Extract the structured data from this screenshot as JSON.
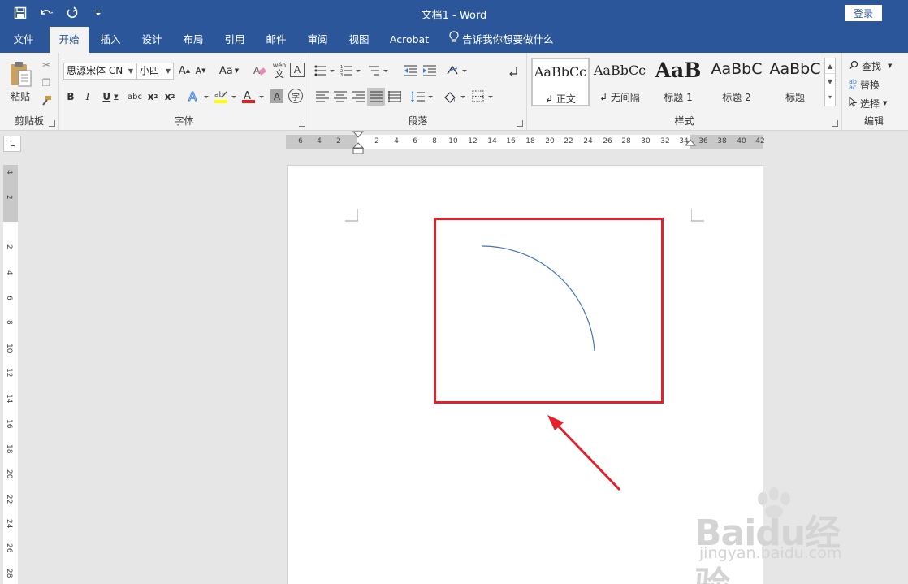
{
  "window": {
    "title": "文档1  -  Word",
    "login_label": "登录"
  },
  "qat": {
    "save_icon": "save-icon",
    "undo_icon": "undo-icon",
    "redo_icon": "redo-icon"
  },
  "tabs": [
    {
      "label": "文件"
    },
    {
      "label": "开始",
      "active": true
    },
    {
      "label": "插入"
    },
    {
      "label": "设计"
    },
    {
      "label": "布局"
    },
    {
      "label": "引用"
    },
    {
      "label": "邮件"
    },
    {
      "label": "审阅"
    },
    {
      "label": "视图"
    },
    {
      "label": "Acrobat"
    }
  ],
  "tellme": "告诉我你想要做什么",
  "ribbon": {
    "clipboard": {
      "label": "剪贴板",
      "paste_label": "粘贴"
    },
    "font": {
      "label": "字体",
      "font_name": "思源宋体 CN",
      "font_size": "小四",
      "aa_label": "Aa",
      "wen_label": "wén",
      "wen_char": "文"
    },
    "paragraph": {
      "label": "段落"
    },
    "styles": {
      "label": "样式",
      "items": [
        {
          "sample": "AaBbCc",
          "name": "↲ 正文"
        },
        {
          "sample": "AaBbCc",
          "name": "↲ 无间隔"
        },
        {
          "sample": "AaB",
          "name": "标题 1"
        },
        {
          "sample": "AaBbC",
          "name": "标题 2"
        },
        {
          "sample": "AaBbC",
          "name": "标题"
        }
      ]
    },
    "editing": {
      "label": "编辑",
      "find": "查找",
      "replace": "替换",
      "select": "选择"
    }
  },
  "ruler": {
    "corner": "L",
    "h_ticks": [
      "6",
      "4",
      "2",
      "2",
      "4",
      "6",
      "8",
      "10",
      "12",
      "14",
      "16",
      "18",
      "20",
      "22",
      "24",
      "26",
      "28",
      "30",
      "32",
      "34",
      "36",
      "38",
      "40",
      "42"
    ],
    "v_ticks": [
      "4",
      "2",
      "2",
      "4",
      "6",
      "8",
      "10",
      "12",
      "14",
      "16",
      "18",
      "20",
      "22",
      "24",
      "26",
      "28"
    ]
  },
  "watermark": {
    "main": "Baidu经验",
    "sub": "jingyan.baidu.com"
  },
  "colors": {
    "brand": "#2b579a",
    "highlight": "#e5202a",
    "arc": "#4472c4"
  }
}
